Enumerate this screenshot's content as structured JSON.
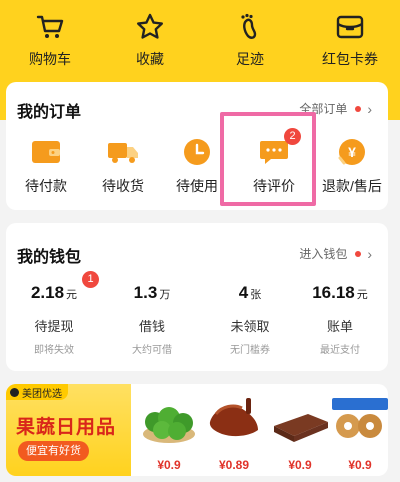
{
  "top_nav": [
    {
      "label": "购物车",
      "icon": "cart-icon"
    },
    {
      "label": "收藏",
      "icon": "star-icon"
    },
    {
      "label": "足迹",
      "icon": "footprint-icon"
    },
    {
      "label": "红包卡券",
      "icon": "coupon-icon"
    }
  ],
  "orders": {
    "title": "我的订单",
    "all_link": "全部订单",
    "items": [
      {
        "label": "待付款",
        "icon": "wallet-icon"
      },
      {
        "label": "待收货",
        "icon": "truck-icon"
      },
      {
        "label": "待使用",
        "icon": "clock-icon"
      },
      {
        "label": "待评价",
        "icon": "comment-icon",
        "badge": "2"
      },
      {
        "label": "退款/售后",
        "icon": "refund-icon"
      }
    ]
  },
  "wallet": {
    "title": "我的钱包",
    "enter_link": "进入钱包",
    "items": [
      {
        "value": "2.18",
        "unit": "元",
        "label": "待提现",
        "sub": "即将失效",
        "badge": "1"
      },
      {
        "value": "1.3",
        "unit": "万",
        "label": "借钱",
        "sub": "大约可借"
      },
      {
        "value": "4",
        "unit": "张",
        "label": "未领取",
        "sub": "无门槛券"
      },
      {
        "value": "16.18",
        "unit": "元",
        "label": "账单",
        "sub": "最近支付"
      }
    ]
  },
  "promo": {
    "brand": "美团优选",
    "title": "果蔬日用品",
    "button": "便宜有好货",
    "products": [
      {
        "name": "limes",
        "price": "¥0.9"
      },
      {
        "name": "braised-duck",
        "price": "¥0.89"
      },
      {
        "name": "bean-curd-snack",
        "price": "¥0.9"
      },
      {
        "name": "donuts",
        "price": "¥0.9"
      }
    ]
  },
  "colors": {
    "brand_yellow": "#ffd21e",
    "accent_red": "#f0483e",
    "order_icon_orange": "#f59b1d",
    "highlight_pink": "#ef6aa5",
    "price_red": "#e0332a"
  }
}
